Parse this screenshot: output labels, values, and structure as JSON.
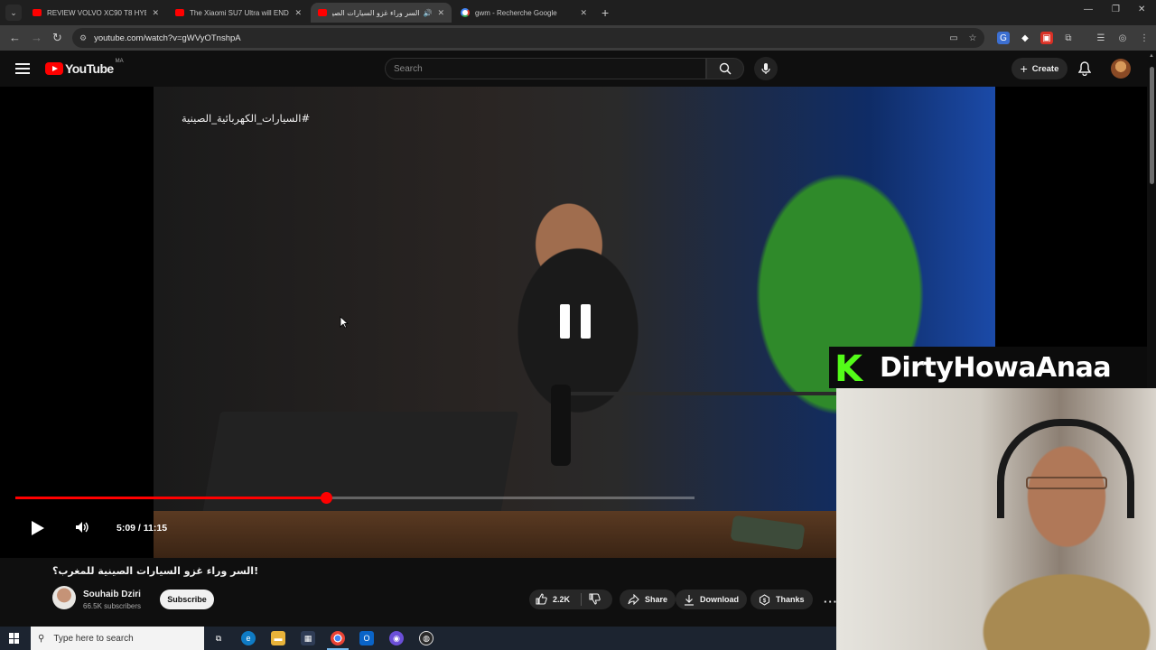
{
  "browser": {
    "tabs": [
      {
        "title": "REVIEW VOLVO XC90 T8 HYBRI",
        "active": false
      },
      {
        "title": "The Xiaomi SU7 Ultra will END",
        "active": false
      },
      {
        "title": "السر وراء غزو السيارات الصينية",
        "active": true
      },
      {
        "title": "gwm - Recherche Google",
        "active": false
      }
    ],
    "url": "youtube.com/watch?v=gWVyOTnshpA"
  },
  "youtube": {
    "logo_text": "YouTube",
    "country_code": "MA",
    "search_placeholder": "Search",
    "create_label": "Create"
  },
  "player": {
    "hashtag": "#السيارات_الكهربائية_الصينية",
    "current_time": "5:09",
    "duration": "11:15",
    "time_display": "5:09 / 11:15",
    "progress_fraction": 0.4578,
    "state": "playing"
  },
  "overlay": {
    "streamer_name": "DirtyHowaAnaa",
    "kick_letter": "K"
  },
  "video_info": {
    "title": "!السر وراء غزو السيارات الصينية للمغرب؟",
    "channel_name": "Souhaib Dziri",
    "subscribers": "66.5K subscribers",
    "subscribe_label": "Subscribe",
    "likes": "2.2K",
    "share_label": "Share",
    "download_label": "Download",
    "thanks_label": "Thanks",
    "more_label": "···"
  },
  "taskbar": {
    "search_placeholder": "Type here to search"
  },
  "colors": {
    "youtube_red": "#ff0000",
    "kick_green": "#53fc18",
    "background": "#0f0f0f"
  }
}
